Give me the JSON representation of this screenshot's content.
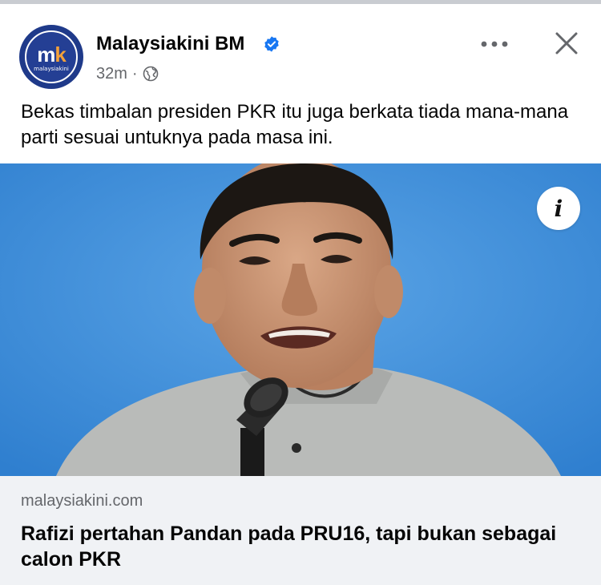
{
  "post": {
    "page_name": "Malaysiakini BM",
    "time": "32m",
    "separator": "·",
    "text": "Bekas timbalan presiden PKR itu juga berkata tiada mana-mana parti sesuai untuknya pada masa ini."
  },
  "avatar": {
    "logo_m": "m",
    "logo_k": "k",
    "logo_sub": "malaysiakini"
  },
  "icons": {
    "verified": "verified-badge-icon",
    "privacy": "globe-icon",
    "more": "more-options-icon",
    "close": "close-icon",
    "info": "info-icon"
  },
  "info_button": {
    "glyph": "i"
  },
  "link_preview": {
    "domain": "malaysiakini.com",
    "title": "Rafizi pertahan Pandan pada PRU16, tapi bukan sebagai calon PKR"
  },
  "colors": {
    "brand_blue": "#1f3a8a",
    "verified_blue": "#1877f2",
    "secondary_text": "#65676b",
    "link_card_bg": "#f0f2f5",
    "photo_bg": "#3f8fd8"
  }
}
